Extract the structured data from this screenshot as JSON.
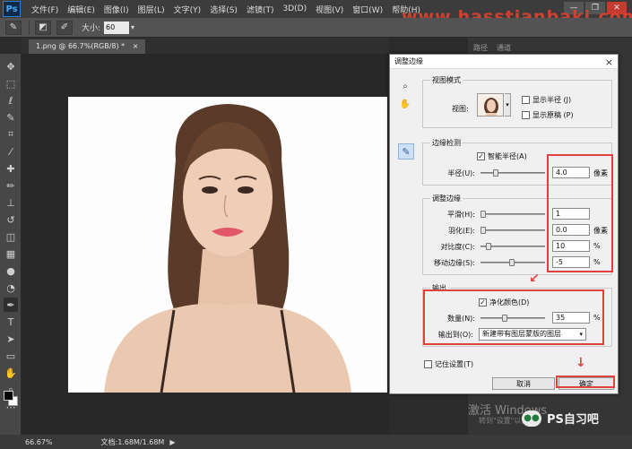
{
  "app": {
    "logo": "Ps",
    "menu": [
      "文件(F)",
      "编辑(E)",
      "图像(I)",
      "图层(L)",
      "文字(Y)",
      "选择(S)",
      "滤镜(T)",
      "3D(D)",
      "视图(V)",
      "窗口(W)",
      "帮助(H)"
    ],
    "window_buttons": [
      "—",
      "❐",
      "✕"
    ],
    "watermark": "www.hasstianbaki.com"
  },
  "options": {
    "size_label": "大小:",
    "size_value": "60"
  },
  "document": {
    "tab_label": "1.png @ 66.7%(RGB/8) *",
    "tab_close": "×"
  },
  "status": {
    "zoom": "66.67%",
    "doc": "文档:1.68M/1.68M"
  },
  "panel": {
    "tabs": [
      "路径",
      "通道"
    ]
  },
  "windows_notice": {
    "title": "激活 Windows",
    "subtitle": "转到\"设置\"以激活"
  },
  "brand": {
    "name": "PS自习吧"
  },
  "dialog": {
    "title": "调整边缘",
    "close": "×",
    "view_mode": {
      "title": "视图模式",
      "view_label": "视图:",
      "show_radius": "显示半径 (J)",
      "show_original": "显示原稿 (P)"
    },
    "edge_detection": {
      "title": "边缘检测",
      "smart_radius": "智能半径(A)",
      "radius_label": "半径(U):",
      "radius_value": "4.0",
      "radius_unit": "像素"
    },
    "adjust_edge": {
      "title": "调整边缘",
      "rows": [
        {
          "label": "平滑(H):",
          "value": "1",
          "unit": ""
        },
        {
          "label": "羽化(E):",
          "value": "0.0",
          "unit": "像素"
        },
        {
          "label": "对比度(C):",
          "value": "10",
          "unit": "%"
        },
        {
          "label": "移动边缘(S):",
          "value": "-5",
          "unit": "%"
        }
      ]
    },
    "output": {
      "title": "输出",
      "decontaminate": "净化颜色(D)",
      "amount_label": "数量(N):",
      "amount_value": "35",
      "amount_unit": "%",
      "output_to_label": "输出到(O):",
      "output_to_value": "新建带有图层蒙版的图层"
    },
    "remember": "记住设置(T)",
    "cancel": "取消",
    "ok": "确定"
  },
  "colors": {
    "accent_red": "#e0413a",
    "ps_blue": "#45a7ff"
  }
}
